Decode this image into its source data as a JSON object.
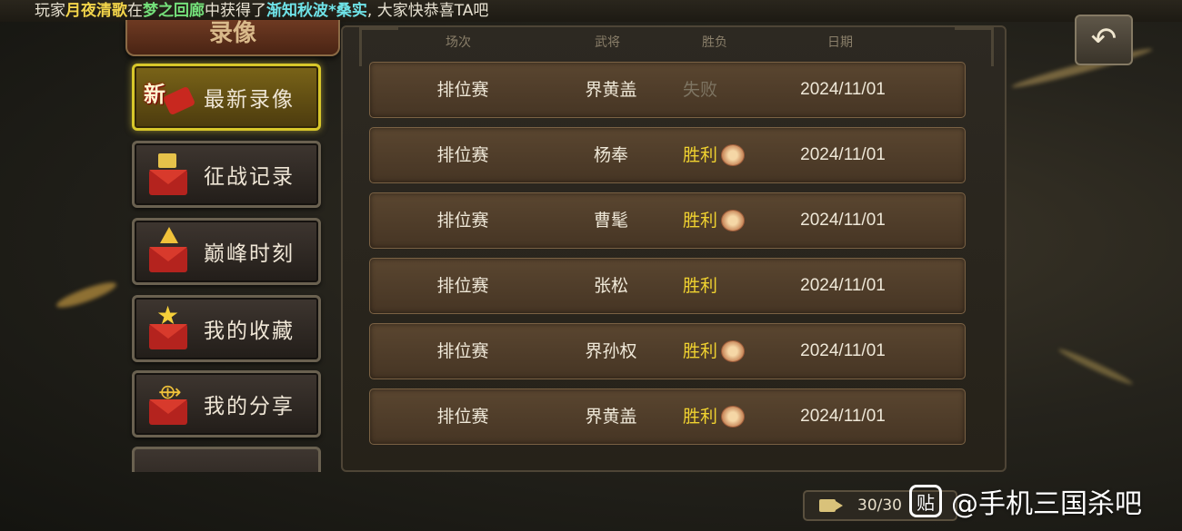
{
  "marquee": {
    "p1": "玩家",
    "player": "月夜清歌",
    "p2": "在",
    "location": "梦之回廊",
    "p3": "中获得了",
    "item": "渐知秋波*桑实",
    "p4": ", 大家快恭喜TA吧"
  },
  "title": "录像",
  "sidebar": {
    "new_badge": "新",
    "items": [
      {
        "label": "最新录像",
        "icon": "new-ribbon-icon",
        "active": true
      },
      {
        "label": "征战记录",
        "icon": "flag-envelope-icon",
        "active": false
      },
      {
        "label": "巅峰时刻",
        "icon": "arrow-envelope-icon",
        "active": false
      },
      {
        "label": "我的收藏",
        "icon": "star-envelope-icon",
        "active": false
      },
      {
        "label": "我的分享",
        "icon": "share-envelope-icon",
        "active": false
      }
    ]
  },
  "table": {
    "headers": {
      "type": "场次",
      "general": "武将",
      "result": "胜负",
      "date": "日期"
    },
    "rows": [
      {
        "type": "排位赛",
        "general": "界黄盖",
        "result": "失败",
        "win": false,
        "medal": false,
        "date": "2024/11/01"
      },
      {
        "type": "排位赛",
        "general": "杨奉",
        "result": "胜利",
        "win": true,
        "medal": true,
        "date": "2024/11/01"
      },
      {
        "type": "排位赛",
        "general": "曹髦",
        "result": "胜利",
        "win": true,
        "medal": true,
        "date": "2024/11/01"
      },
      {
        "type": "排位赛",
        "general": "张松",
        "result": "胜利",
        "win": true,
        "medal": false,
        "date": "2024/11/01"
      },
      {
        "type": "排位赛",
        "general": "界孙权",
        "result": "胜利",
        "win": true,
        "medal": true,
        "date": "2024/11/01"
      },
      {
        "type": "排位赛",
        "general": "界黄盖",
        "result": "胜利",
        "win": true,
        "medal": true,
        "date": "2024/11/01"
      }
    ]
  },
  "back_icon": "back-arrow-icon",
  "storage": {
    "count": "30/30"
  },
  "watermark": {
    "text": "@手机三国杀吧",
    "logo": "贴"
  },
  "colors": {
    "win": "#f0d230",
    "lose": "#7d7462",
    "active_border": "#d8c72a"
  }
}
